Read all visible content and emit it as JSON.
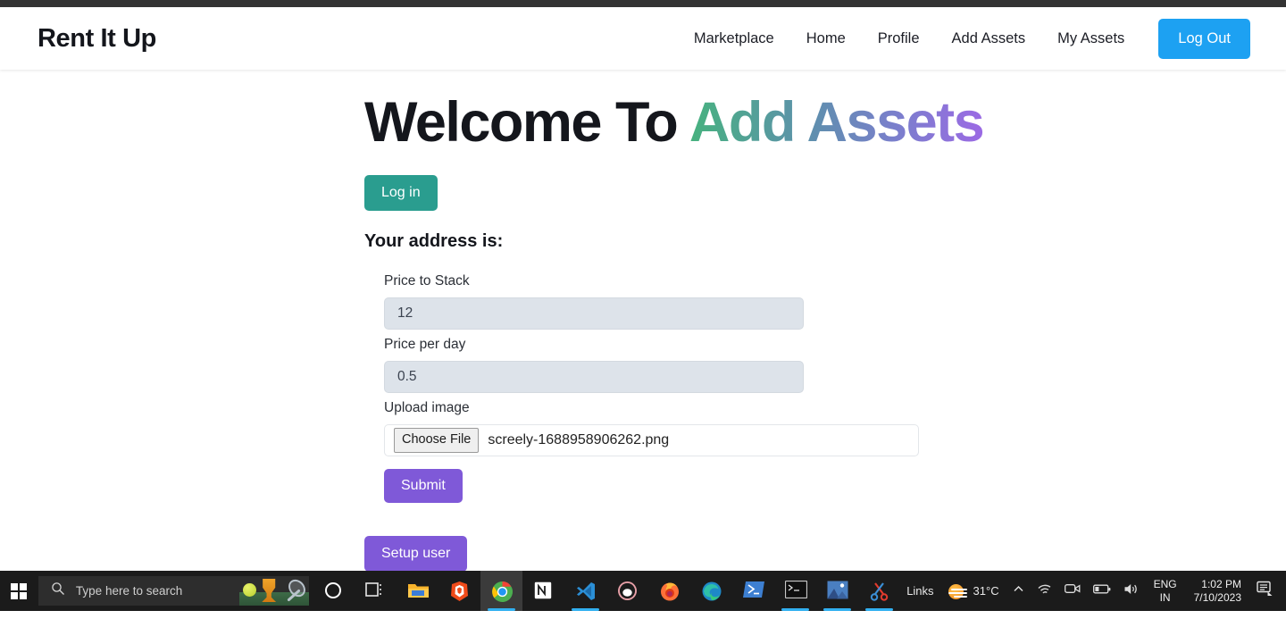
{
  "navbar": {
    "brand": "Rent It Up",
    "links": [
      {
        "label": "Marketplace"
      },
      {
        "label": "Home"
      },
      {
        "label": "Profile"
      },
      {
        "label": "Add Assets"
      },
      {
        "label": "My Assets"
      }
    ],
    "logout_label": "Log Out",
    "logout_color": "#1da1f2"
  },
  "main": {
    "heading_prefix": "Welcome To ",
    "heading_accent": "Add Assets",
    "heading_gradient_from": "#47b27f",
    "heading_gradient_to": "#9b6ae4",
    "login_label": "Log in",
    "login_color": "#2a9d8f",
    "address_label": "Your address is:",
    "form": {
      "fields": [
        {
          "label": "Price to Stack",
          "value": "12"
        },
        {
          "label": "Price per day",
          "value": "0.5"
        }
      ],
      "upload_label": "Upload image",
      "choose_file_label": "Choose File",
      "file_name": "screely-1688958906262.png",
      "submit_label": "Submit",
      "submit_color": "#7f59d8"
    },
    "setup_user_label": "Setup user"
  },
  "taskbar": {
    "start_icon": "windows-logo-icon",
    "search_placeholder": "Type here to search",
    "search_icon": "search-icon",
    "tasks": [
      {
        "name": "cortana-icon",
        "active": false,
        "open": false
      },
      {
        "name": "task-view-icon",
        "active": false,
        "open": false
      },
      {
        "name": "file-explorer-icon",
        "active": false,
        "open": false
      },
      {
        "name": "brave-browser-icon",
        "active": false,
        "open": false
      },
      {
        "name": "google-chrome-icon",
        "active": true,
        "open": true
      },
      {
        "name": "notion-icon",
        "active": false,
        "open": false
      },
      {
        "name": "vs-code-icon",
        "active": false,
        "open": true
      },
      {
        "name": "opera-gx-icon",
        "active": false,
        "open": false
      },
      {
        "name": "firefox-icon",
        "active": false,
        "open": false
      },
      {
        "name": "microsoft-edge-icon",
        "active": false,
        "open": false
      },
      {
        "name": "powershell-icon",
        "active": false,
        "open": false
      },
      {
        "name": "terminal-icon",
        "active": false,
        "open": true
      },
      {
        "name": "photos-icon",
        "active": false,
        "open": true
      },
      {
        "name": "snipping-tool-icon",
        "active": false,
        "open": true
      }
    ],
    "tray": {
      "links_label": "Links",
      "weather_temp": "31°C",
      "weather_icon": "sun-haze-icon",
      "chevron_icon": "chevron-up-icon",
      "wifi_icon": "wifi-icon",
      "meet-now_icon": "meet-now-icon",
      "battery_icon": "battery-icon",
      "volume_icon": "volume-icon",
      "language_primary": "ENG",
      "language_secondary": "IN",
      "time": "1:02 PM",
      "date": "7/10/2023",
      "notification_icon": "notification-center-icon"
    }
  }
}
